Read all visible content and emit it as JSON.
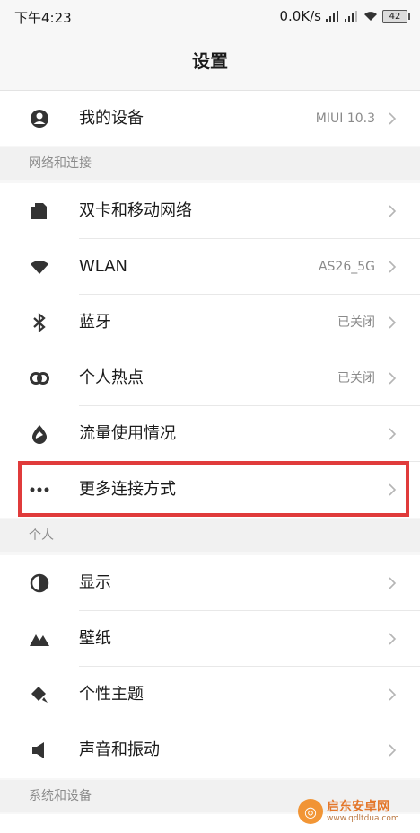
{
  "status": {
    "time": "下午4:23",
    "net_speed": "0.0K/s",
    "battery": "42"
  },
  "header": {
    "title": "设置"
  },
  "top_item": {
    "label": "我的设备",
    "value": "MIUI 10.3",
    "icon": "account-icon"
  },
  "sections": [
    {
      "title": "网络和连接"
    },
    {
      "title": "个人"
    },
    {
      "title": "系统和设备"
    }
  ],
  "network_items": [
    {
      "label": "双卡和移动网络",
      "value": "",
      "icon": "sim-card-icon"
    },
    {
      "label": "WLAN",
      "value": "AS26_5G",
      "icon": "wifi-icon"
    },
    {
      "label": "蓝牙",
      "value": "已关闭",
      "icon": "bluetooth-icon"
    },
    {
      "label": "个人热点",
      "value": "已关闭",
      "icon": "hotspot-icon"
    },
    {
      "label": "流量使用情况",
      "value": "",
      "icon": "data-usage-icon"
    },
    {
      "label": "更多连接方式",
      "value": "",
      "icon": "more-icon"
    }
  ],
  "personal_items": [
    {
      "label": "显示",
      "value": "",
      "icon": "display-icon"
    },
    {
      "label": "壁纸",
      "value": "",
      "icon": "wallpaper-icon"
    },
    {
      "label": "个性主题",
      "value": "",
      "icon": "theme-icon"
    },
    {
      "label": "声音和振动",
      "value": "",
      "icon": "sound-icon"
    }
  ],
  "watermark": {
    "title": "启东安卓网",
    "url": "www.qdltdua.com"
  },
  "colors": {
    "highlight": "#e03b3b",
    "section_bg": "#f1f1f1"
  }
}
